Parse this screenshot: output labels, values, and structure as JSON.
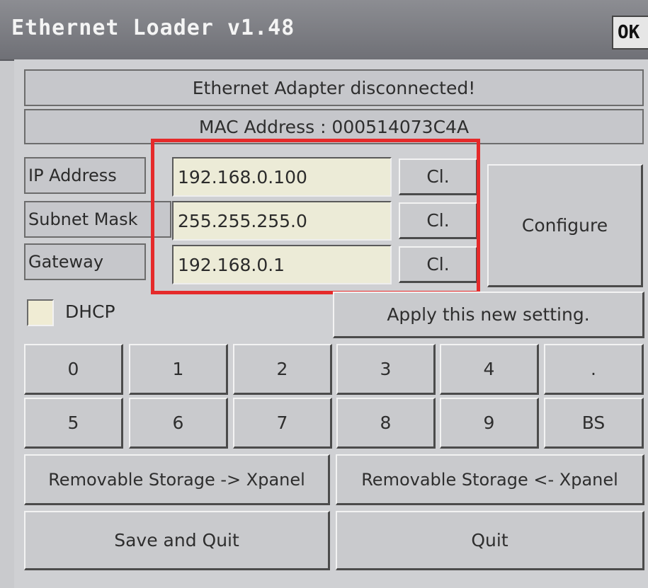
{
  "window": {
    "title": "Ethernet Loader v1.48",
    "ok_label": "OK"
  },
  "status": {
    "connection": "Ethernet Adapter disconnected!",
    "mac": "MAC Address : 000514073C4A"
  },
  "network": {
    "fields": [
      {
        "label": "IP Address",
        "value": "192.168.0.100",
        "clear_label": "Cl."
      },
      {
        "label": "Subnet Mask",
        "value": "255.255.255.0",
        "clear_label": "Cl."
      },
      {
        "label": "Gateway",
        "value": "192.168.0.1",
        "clear_label": "Cl."
      }
    ],
    "configure_label": "Configure",
    "dhcp_label": "DHCP",
    "dhcp_checked": false,
    "apply_label": "Apply this new setting."
  },
  "keypad": {
    "row1": [
      "0",
      "1",
      "2",
      "3",
      "4",
      "."
    ],
    "row2": [
      "5",
      "6",
      "7",
      "8",
      "9",
      "BS"
    ]
  },
  "actions": {
    "storage_to_xpanel": "Removable Storage -> Xpanel",
    "xpanel_to_storage": "Removable Storage <- Xpanel",
    "save_quit": "Save and Quit",
    "quit": "Quit"
  },
  "highlight_color": "#e52a2a"
}
